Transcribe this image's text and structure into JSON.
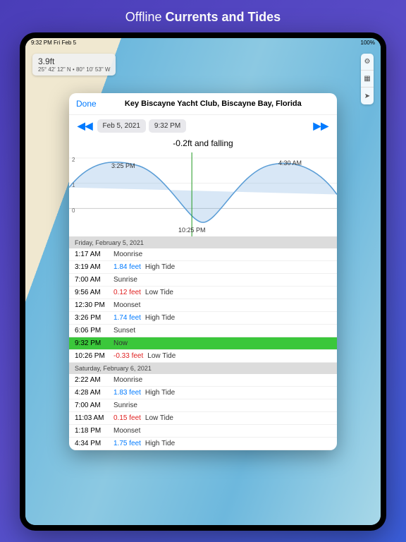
{
  "promo": {
    "prefix": "Offline ",
    "bold": "Currents and Tides"
  },
  "status_bar": {
    "left": "9:32 PM Fri Feb 5",
    "right": "100%"
  },
  "info_box": {
    "depth": "3.9ft",
    "coords": "25° 42' 12\" N • 80° 10' 53\" W"
  },
  "map_tools": {
    "settings": "⚙",
    "layers": "▦",
    "locate": "➤"
  },
  "modal": {
    "done": "Done",
    "title": "Key Biscayne Yacht Club, Biscayne Bay, Florida",
    "prev": "◀◀",
    "next": "▶▶",
    "date_pill": "Feb 5, 2021",
    "time_pill": "9:32 PM",
    "status": "-0.2ft and falling"
  },
  "chart_data": {
    "type": "line",
    "ylabel": "ft",
    "ylim": [
      -1,
      2
    ],
    "yticks": [
      0,
      1,
      2
    ],
    "points": [
      {
        "time": "3:25 PM",
        "value": 1.74,
        "kind": "high"
      },
      {
        "time": "10:25 PM",
        "value": -0.33,
        "kind": "low"
      },
      {
        "time": "4:30 AM",
        "value": 1.83,
        "kind": "high"
      }
    ],
    "now_marker": "9:32 PM"
  },
  "days": [
    {
      "header": "Friday, February 5, 2021",
      "events": [
        {
          "time": "1:17 AM",
          "value": "",
          "label": "Moonrise",
          "type": ""
        },
        {
          "time": "3:19 AM",
          "value": "1.84 feet",
          "label": "High Tide",
          "type": "high"
        },
        {
          "time": "7:00 AM",
          "value": "",
          "label": "Sunrise",
          "type": ""
        },
        {
          "time": "9:56 AM",
          "value": "0.12 feet",
          "label": "Low Tide",
          "type": "low"
        },
        {
          "time": "12:30 PM",
          "value": "",
          "label": "Moonset",
          "type": ""
        },
        {
          "time": "3:26 PM",
          "value": "1.74 feet",
          "label": "High Tide",
          "type": "high"
        },
        {
          "time": "6:06 PM",
          "value": "",
          "label": "Sunset",
          "type": ""
        },
        {
          "time": "9:32 PM",
          "value": "",
          "label": "Now",
          "type": "now"
        },
        {
          "time": "10:26 PM",
          "value": "-0.33 feet",
          "label": "Low Tide",
          "type": "low"
        }
      ]
    },
    {
      "header": "Saturday, February 6, 2021",
      "events": [
        {
          "time": "2:22 AM",
          "value": "",
          "label": "Moonrise",
          "type": ""
        },
        {
          "time": "4:28 AM",
          "value": "1.83 feet",
          "label": "High Tide",
          "type": "high"
        },
        {
          "time": "7:00 AM",
          "value": "",
          "label": "Sunrise",
          "type": ""
        },
        {
          "time": "11:03 AM",
          "value": "0.15 feet",
          "label": "Low Tide",
          "type": "low"
        },
        {
          "time": "1:18 PM",
          "value": "",
          "label": "Moonset",
          "type": ""
        },
        {
          "time": "4:34 PM",
          "value": "1.75 feet",
          "label": "High Tide",
          "type": "high"
        }
      ]
    }
  ]
}
